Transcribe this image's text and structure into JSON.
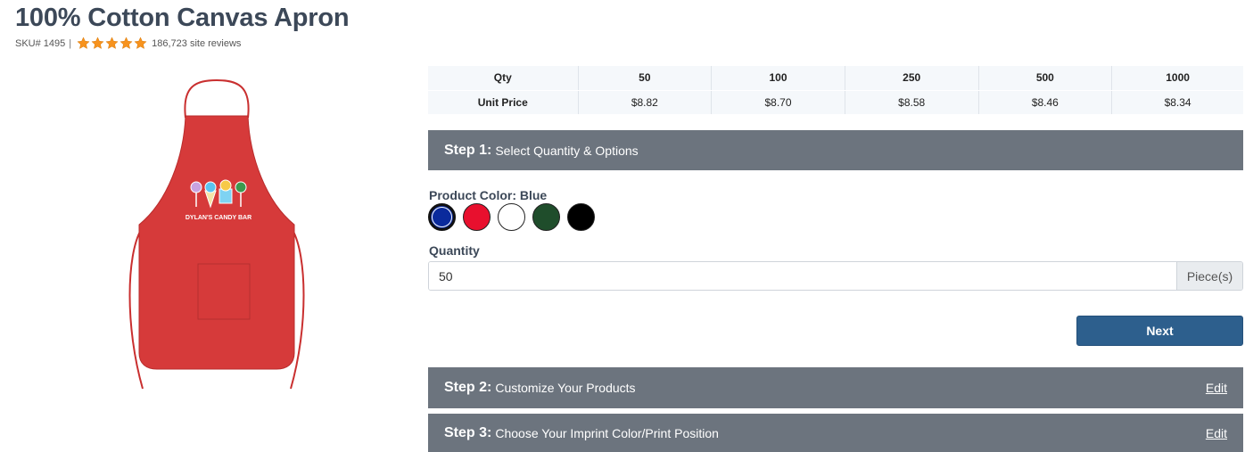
{
  "product": {
    "title": "100% Cotton Canvas Apron",
    "sku": "SKU# 1495",
    "separator": "|",
    "rating_stars": 5,
    "reviews_text": "186,723 site reviews",
    "star_color": "#f7931e",
    "image_imprint_text": "DYLAN'S CANDY BAR",
    "image_color": "#d63a3a"
  },
  "pricing": {
    "qty_label": "Qty",
    "price_label": "Unit Price",
    "tiers": [
      {
        "qty": "50",
        "price": "$8.82"
      },
      {
        "qty": "100",
        "price": "$8.70"
      },
      {
        "qty": "250",
        "price": "$8.58"
      },
      {
        "qty": "500",
        "price": "$8.46"
      },
      {
        "qty": "1000",
        "price": "$8.34"
      }
    ]
  },
  "steps": [
    {
      "num": "Step 1:",
      "label": "Select Quantity & Options",
      "edit": ""
    },
    {
      "num": "Step 2:",
      "label": "Customize Your Products",
      "edit": "Edit"
    },
    {
      "num": "Step 3:",
      "label": "Choose Your Imprint Color/Print Position",
      "edit": "Edit"
    }
  ],
  "color": {
    "label": "Product Color: Blue",
    "options": [
      {
        "name": "blue",
        "hex": "#0a2a9c",
        "selected": true
      },
      {
        "name": "red",
        "hex": "#e8102e",
        "selected": false
      },
      {
        "name": "white",
        "hex": "#ffffff",
        "selected": false
      },
      {
        "name": "green",
        "hex": "#1f4d2b",
        "selected": false
      },
      {
        "name": "black",
        "hex": "#000000",
        "selected": false
      }
    ]
  },
  "quantity": {
    "label": "Quantity",
    "value": "50",
    "unit": "Piece(s)"
  },
  "actions": {
    "next_label": "Next"
  },
  "theme": {
    "step_bar": "#6c747e",
    "primary": "#2d5f8d"
  }
}
